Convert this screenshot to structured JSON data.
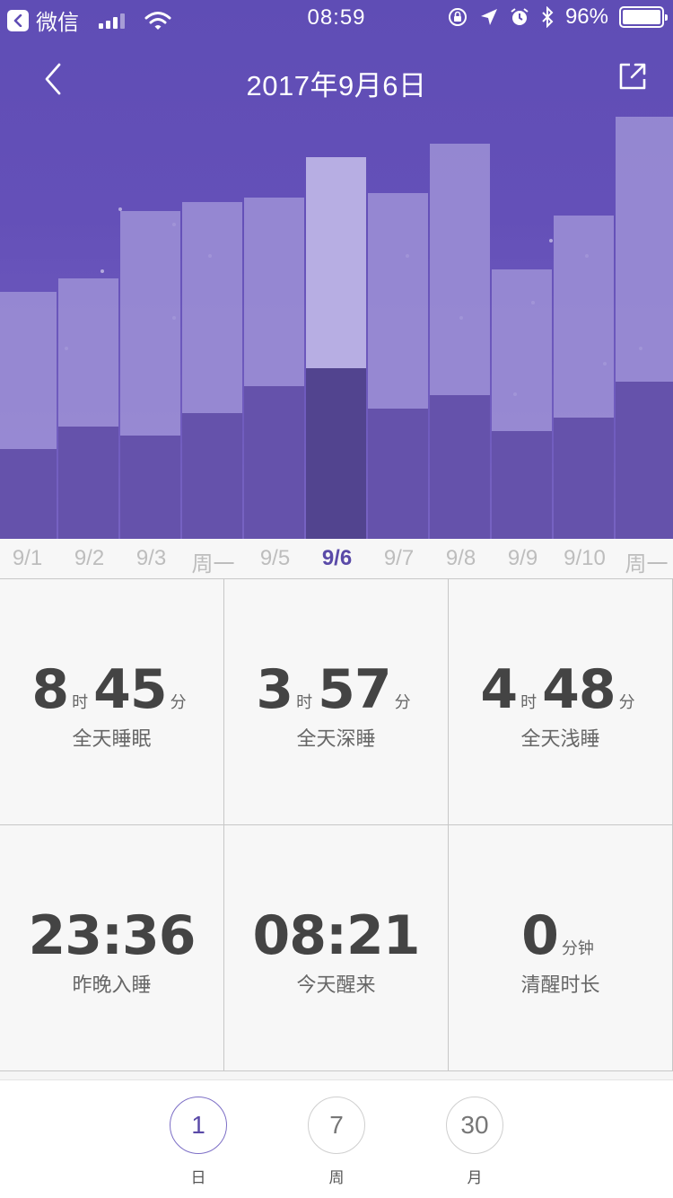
{
  "status_bar": {
    "app_back": "微信",
    "time": "08:59",
    "battery": "96%"
  },
  "nav": {
    "title": "2017年9月6日"
  },
  "colors": {
    "hero_top": "#5f4db5",
    "bar_light": "#9d91d6",
    "bar_dark": "#6552ab",
    "active_light": "#b7aee3",
    "active_dark": "#52448f",
    "accent": "#5a4aa8"
  },
  "chart_data": {
    "type": "bar",
    "categories": [
      "9/1",
      "9/2",
      "9/3",
      "周一",
      "9/5",
      "9/6",
      "9/7",
      "9/8",
      "9/9",
      "9/10",
      "周一"
    ],
    "series": [
      {
        "values": [
          1.0,
          1.25,
          1.15,
          1.4,
          1.7,
          1.9,
          1.45,
          1.6,
          1.2,
          1.35,
          1.75
        ]
      },
      {
        "values": [
          1.75,
          1.65,
          2.5,
          2.35,
          2.1,
          2.35,
          2.4,
          2.8,
          1.8,
          2.25,
          2.95
        ]
      }
    ],
    "selected_index": 5
  },
  "stats": [
    {
      "parts": [
        {
          "n": "8",
          "u": "时"
        },
        {
          "n": "45",
          "u": "分"
        }
      ],
      "label": "全天睡眠"
    },
    {
      "parts": [
        {
          "n": "3",
          "u": "时"
        },
        {
          "n": "57",
          "u": "分"
        }
      ],
      "label": "全天深睡"
    },
    {
      "parts": [
        {
          "n": "4",
          "u": "时"
        },
        {
          "n": "48",
          "u": "分"
        }
      ],
      "label": "全天浅睡"
    },
    {
      "parts": [
        {
          "n": "23:36",
          "u": ""
        }
      ],
      "label": "昨晚入睡"
    },
    {
      "parts": [
        {
          "n": "08:21",
          "u": ""
        }
      ],
      "label": "今天醒来"
    },
    {
      "parts": [
        {
          "n": "0",
          "u": "分钟"
        }
      ],
      "label": "清醒时长"
    }
  ],
  "tabs": [
    {
      "num": "1",
      "label": "日",
      "active": true
    },
    {
      "num": "7",
      "label": "周",
      "active": false
    },
    {
      "num": "30",
      "label": "月",
      "active": false
    }
  ]
}
